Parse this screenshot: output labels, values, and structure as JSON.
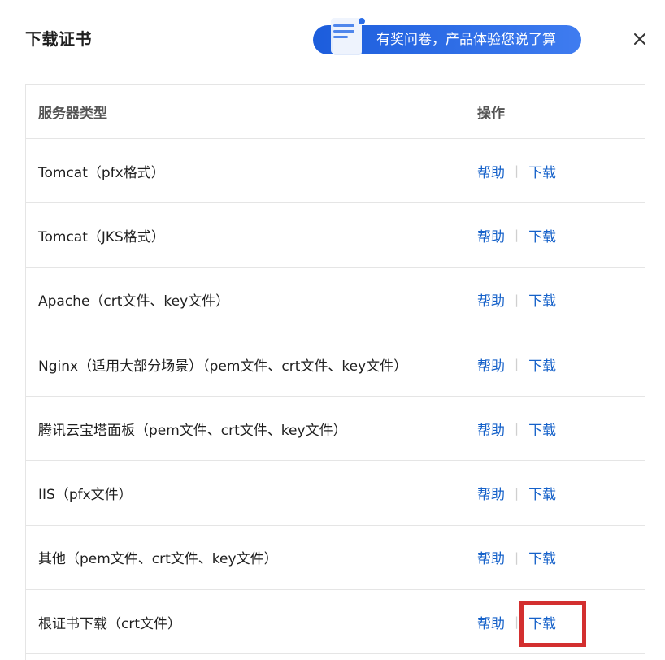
{
  "dialog": {
    "title": "下载证书",
    "survey_text": "有奖问卷，产品体验您说了算"
  },
  "table": {
    "headers": {
      "type": "服务器类型",
      "operation": "操作"
    },
    "rows": [
      {
        "type": "Tomcat（pfx格式）",
        "help": "帮助",
        "download": "下载"
      },
      {
        "type": "Tomcat（JKS格式）",
        "help": "帮助",
        "download": "下载"
      },
      {
        "type": "Apache（crt文件、key文件）",
        "help": "帮助",
        "download": "下载"
      },
      {
        "type": "Nginx（适用大部分场景）（pem文件、crt文件、key文件）",
        "help": "帮助",
        "download": "下载"
      },
      {
        "type": "腾讯云宝塔面板（pem文件、crt文件、key文件）",
        "help": "帮助",
        "download": "下载"
      },
      {
        "type": "IIS（pfx文件）",
        "help": "帮助",
        "download": "下载"
      },
      {
        "type": "其他（pem文件、crt文件、key文件）",
        "help": "帮助",
        "download": "下载"
      },
      {
        "type": "根证书下载（crt文件）",
        "help": "帮助",
        "download": "下载"
      }
    ],
    "separator": "|"
  },
  "colors": {
    "link": "#1561c9",
    "banner": "#2a6de8",
    "highlight": "#d32f2f"
  },
  "icons": {
    "survey": "survey-document-icon",
    "close": "close-icon"
  }
}
